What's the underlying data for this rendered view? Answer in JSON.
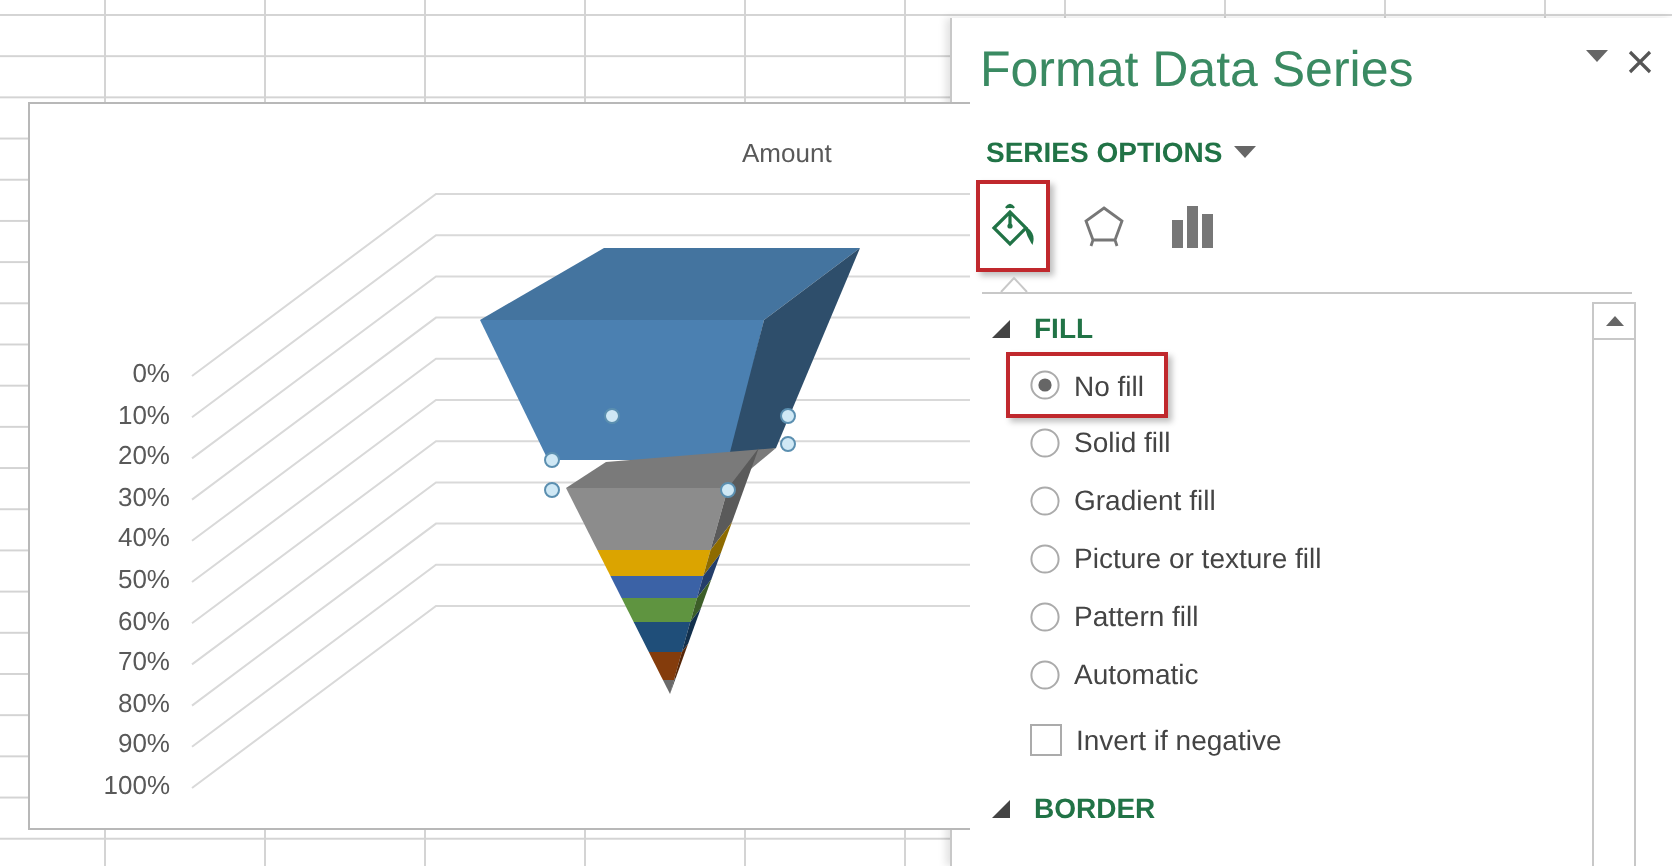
{
  "chart": {
    "title": "Amount",
    "axis_labels": [
      "0%",
      "10%",
      "20%",
      "30%",
      "40%",
      "50%",
      "60%",
      "70%",
      "80%",
      "90%",
      "100%"
    ]
  },
  "panel": {
    "title": "Format Data Series",
    "section_menu": "SERIES OPTIONS",
    "tabs": [
      {
        "kind": "fill",
        "selected": true,
        "highlighted": true
      },
      {
        "kind": "effects",
        "selected": false,
        "highlighted": false
      },
      {
        "kind": "options",
        "selected": false,
        "highlighted": false
      }
    ],
    "sections": [
      {
        "title": "FILL",
        "expanded": true,
        "options": [
          {
            "kind": "radio",
            "label": "No fill",
            "checked": true,
            "highlighted": true
          },
          {
            "kind": "radio",
            "label": "Solid fill",
            "checked": false,
            "highlighted": false
          },
          {
            "kind": "radio",
            "label": "Gradient fill",
            "checked": false,
            "highlighted": false
          },
          {
            "kind": "radio",
            "label": "Picture or texture fill",
            "checked": false,
            "highlighted": false
          },
          {
            "kind": "radio",
            "label": "Pattern fill",
            "checked": false,
            "highlighted": false
          },
          {
            "kind": "radio",
            "label": "Automatic",
            "checked": false,
            "highlighted": false
          },
          {
            "kind": "checkbox",
            "label": "Invert if negative",
            "checked": false,
            "highlighted": false
          }
        ]
      },
      {
        "title": "BORDER",
        "expanded": true
      }
    ]
  }
}
